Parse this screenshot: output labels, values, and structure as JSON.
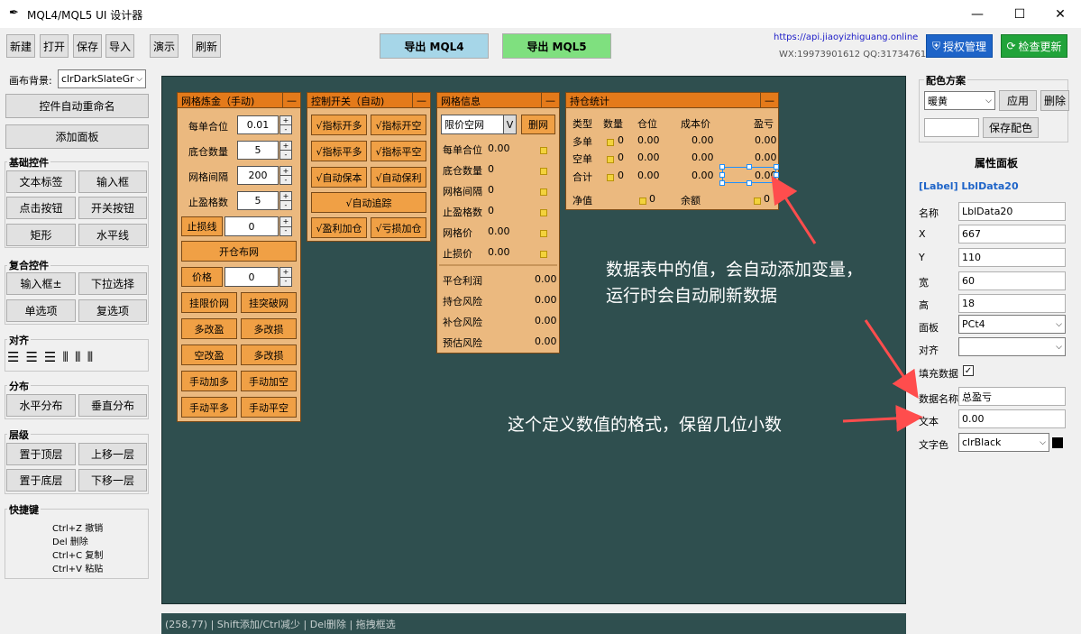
{
  "window": {
    "title": "MQL4/MQL5 UI 设计器",
    "minimize": "—",
    "maximize": "☐",
    "close": "✕"
  },
  "toolbar": {
    "new": "新建",
    "open": "打开",
    "save": "保存",
    "import": "导入",
    "demo": "演示",
    "refresh": "刷新",
    "export_mql4": "导出 MQL4",
    "export_mql5": "导出 MQL5",
    "website": "https://api.jiaoyizhiguang.online",
    "contact": "WX:19973901612 QQ:317347616",
    "license": "授权管理",
    "update": "检查更新"
  },
  "left": {
    "canvas_bg_label": "画布背景:",
    "canvas_bg_value": "clrDarkSlateGr",
    "auto_rename": "控件自动重命名",
    "add_panel": "添加面板",
    "basic_title": "基础控件",
    "basic": [
      "文本标签",
      "输入框",
      "点击按钮",
      "开关按钮",
      "矩形",
      "水平线"
    ],
    "composite_title": "复合控件",
    "composite": [
      "输入框±",
      "下拉选择",
      "单选项",
      "复选项"
    ],
    "align_title": "对齐",
    "distribute_title": "分布",
    "distribute": [
      "水平分布",
      "垂直分布"
    ],
    "layer_title": "层级",
    "layer": [
      "置于顶层",
      "上移一层",
      "置于底层",
      "下移一层"
    ],
    "shortcut_title": "快捷键",
    "shortcuts": [
      "Ctrl+Z 撤销",
      "Del 删除",
      "Ctrl+C 复制",
      "Ctrl+V 粘贴"
    ]
  },
  "status": "(258,77) | Shift添加/Ctrl减少 | Del删除 | 拖拽框选",
  "p1": {
    "title": "网格炼金（手动)",
    "min": "—",
    "rows": [
      {
        "label": "每单合位",
        "value": "0.01"
      },
      {
        "label": "底仓数量",
        "value": "5"
      },
      {
        "label": "网格间隔",
        "value": "200"
      },
      {
        "label": "止盈格数",
        "value": "5"
      }
    ],
    "stoploss_label": "止损线",
    "stoploss_value": "0",
    "open_grid": "开仓布网",
    "price_label": "价格",
    "price_value": "0",
    "buttons": [
      "挂限价网",
      "挂突破网",
      "多改盈",
      "多改损",
      "空改盈",
      "多改损",
      "手动加多",
      "手动加空",
      "手动平多",
      "手动平空"
    ]
  },
  "p2": {
    "title": "控制开关（自动)",
    "min": "—",
    "buttons": [
      "√指标开多",
      "√指标开空",
      "√指标平多",
      "√指标平空",
      "√自动保本",
      "√自动保利"
    ],
    "trail": "√自动追踪",
    "bottom": [
      "√盈利加仓",
      "√亏损加仓"
    ]
  },
  "p3": {
    "title": "网格信息",
    "min": "—",
    "select": "限价空网",
    "v": "V",
    "delete": "删网",
    "rows": [
      {
        "label": "每单合位",
        "value": "0.00"
      },
      {
        "label": "底仓数量",
        "value": "0"
      },
      {
        "label": "网格间隔",
        "value": "0"
      },
      {
        "label": "止盈格数",
        "value": "0"
      },
      {
        "label": "网格价",
        "value": "0.00"
      },
      {
        "label": "止损价",
        "value": "0.00"
      }
    ],
    "rows2": [
      {
        "label": "平仓利润",
        "value": "0.00"
      },
      {
        "label": "持仓风险",
        "value": "0.00"
      },
      {
        "label": "补仓风险",
        "value": "0.00"
      },
      {
        "label": "预估风险",
        "value": "0.00"
      }
    ]
  },
  "p4": {
    "title": "持仓统计",
    "min": "—",
    "headers": [
      "类型",
      "数量",
      "仓位",
      "成本价",
      "盈亏"
    ],
    "rows": [
      [
        "多单",
        "0",
        "0.00",
        "0.00",
        "0.00"
      ],
      [
        "空单",
        "0",
        "0.00",
        "0.00",
        "0.00"
      ],
      [
        "合计",
        "0",
        "0.00",
        "0.00",
        "0.00"
      ]
    ],
    "equity_label": "净值",
    "equity_value": "0",
    "balance_label": "余额",
    "balance_value": "0"
  },
  "annotations": {
    "a1_line1": "数据表中的值，会自动添加变量，",
    "a1_line2": "运行时会自动刷新数据",
    "a2": "这个定义数值的格式，保留几位小数"
  },
  "right": {
    "scheme_title": "配色方案",
    "scheme_value": "暖黄",
    "apply": "应用",
    "delete": "删除",
    "save_scheme": "保存配色",
    "props_title": "属性面板",
    "selected": "[Label] LblData20",
    "fields": [
      {
        "label": "名称",
        "value": "LblData20"
      },
      {
        "label": "X",
        "value": "667"
      },
      {
        "label": "Y",
        "value": "110"
      },
      {
        "label": "宽",
        "value": "60"
      },
      {
        "label": "高",
        "value": "18"
      }
    ],
    "panel_label": "面板",
    "panel_value": "PCt4",
    "align_label": "对齐",
    "align_value": "",
    "fill_label": "填充数据",
    "fill_check": "✓",
    "dataname_label": "数据名称",
    "dataname_value": "总盈亏",
    "text_label": "文本",
    "text_value": "0.00",
    "color_label": "文字色",
    "color_value": "clrBlack"
  },
  "colors": {
    "canvas": "#2f4f4f",
    "panel": "#ebb97f",
    "panel_header": "#e47a1a",
    "mql4": "#a6d6e8",
    "mql5": "#7fe07f",
    "accent_blue": "#1e64c8",
    "update_green": "#21a33a"
  }
}
